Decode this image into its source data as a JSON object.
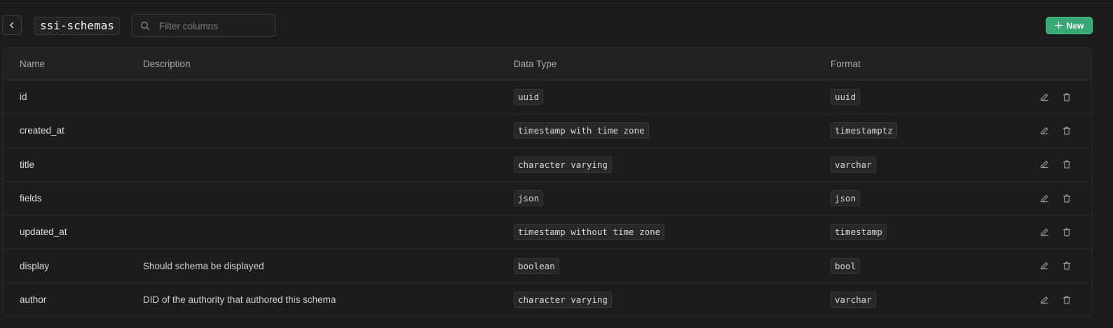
{
  "toolbar": {
    "table_name": "ssi-schemas",
    "search_placeholder": "Filter columns",
    "search_value": "",
    "new_label": "New"
  },
  "table": {
    "headers": {
      "name": "Name",
      "description": "Description",
      "data_type": "Data Type",
      "format": "Format"
    },
    "rows": [
      {
        "name": "id",
        "description": "",
        "data_type": "uuid",
        "format": "uuid"
      },
      {
        "name": "created_at",
        "description": "",
        "data_type": "timestamp with time zone",
        "format": "timestamptz"
      },
      {
        "name": "title",
        "description": "",
        "data_type": "character varying",
        "format": "varchar"
      },
      {
        "name": "fields",
        "description": "",
        "data_type": "json",
        "format": "json"
      },
      {
        "name": "updated_at",
        "description": "",
        "data_type": "timestamp without time zone",
        "format": "timestamp"
      },
      {
        "name": "display",
        "description": "Should schema be displayed",
        "data_type": "boolean",
        "format": "bool"
      },
      {
        "name": "author",
        "description": "DID of the authority that authored this schema",
        "data_type": "character varying",
        "format": "varchar"
      }
    ]
  },
  "icons": {
    "back": "chevron-left-icon",
    "search": "search-icon",
    "new": "plus-icon",
    "edit": "pencil-icon",
    "delete": "trash-icon"
  },
  "colors": {
    "accent": "#38a874",
    "background": "#1c1c1c"
  }
}
